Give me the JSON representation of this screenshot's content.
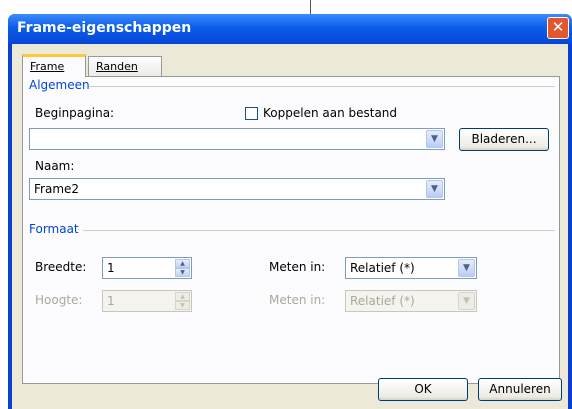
{
  "dialog": {
    "title": "Frame-eigenschappen",
    "close_glyph": "✕"
  },
  "tabs": [
    {
      "label": "Frame",
      "selected": true
    },
    {
      "label": "Randen",
      "selected": false
    }
  ],
  "general": {
    "group_label": "Algemeen",
    "start_page_label": "Beginpagina:",
    "start_page_value": "",
    "link_checkbox_label": "Koppelen aan bestand",
    "link_checkbox_checked": false,
    "browse_button": "Bladeren...",
    "name_label": "Naam:",
    "name_value": "Frame2"
  },
  "format": {
    "group_label": "Formaat",
    "width_label": "Breedte:",
    "width_value": "1",
    "measure_in_label": "Meten in:",
    "measure_in_value": "Relatief (*)",
    "height_label": "Hoogte:",
    "height_value": "1",
    "height_measure_label": "Meten in:",
    "height_measure_value": "Relatief (*)"
  },
  "footer": {
    "ok_button": "OK",
    "cancel_button": "Annuleren"
  },
  "colors": {
    "titlebar": "#0b5de8",
    "group_label": "#0046d5",
    "dialog_face": "#ece9d8"
  }
}
